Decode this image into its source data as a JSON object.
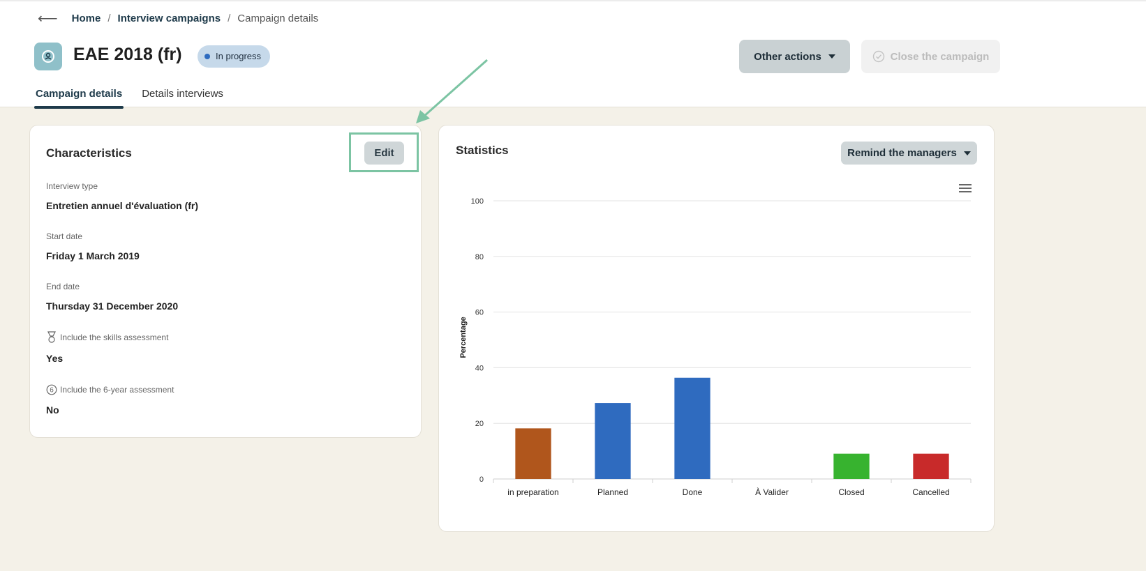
{
  "breadcrumb": {
    "back": "⟵",
    "home": "Home",
    "campaigns": "Interview campaigns",
    "current": "Campaign details",
    "separator": "/"
  },
  "header": {
    "title": "EAE 2018 (fr)",
    "status": "In progress",
    "status_color": "#2e6bbf",
    "other_actions": "Other actions",
    "close_campaign": "Close the campaign"
  },
  "tabs": [
    {
      "label": "Campaign details",
      "active": true
    },
    {
      "label": "Details interviews",
      "active": false
    }
  ],
  "characteristics": {
    "title": "Characteristics",
    "edit": "Edit",
    "fields": [
      {
        "label": "Interview type",
        "value": "Entretien annuel d'évaluation (fr)"
      },
      {
        "label": "Start date",
        "value": "Friday 1 March 2019"
      },
      {
        "label": "End date",
        "value": "Thursday 31 December 2020"
      },
      {
        "label": "Include the skills assessment",
        "value": "Yes",
        "icon": "medal-icon"
      },
      {
        "label": "Include the 6-year assessment",
        "value": "No",
        "icon": "six-circle-icon"
      }
    ]
  },
  "statistics": {
    "title": "Statistics",
    "remind": "Remind the managers"
  },
  "chart_data": {
    "type": "bar",
    "categories": [
      "in preparation",
      "Planned",
      "Done",
      "À Valider",
      "Closed",
      "Cancelled"
    ],
    "values": [
      18.2,
      27.3,
      36.4,
      0,
      9.1,
      9.1
    ],
    "colors": [
      "#b0561c",
      "#2f6bbf",
      "#2f6bbf",
      "#2f6bbf",
      "#37b32f",
      "#c82a2a"
    ],
    "ylabel": "Percentage",
    "ylim": [
      0,
      100
    ],
    "yticks": [
      0,
      20,
      40,
      60,
      80,
      100
    ],
    "grid": true
  },
  "colors": {
    "accent": "#1e3a4a",
    "highlight": "#7cc4a3",
    "background": "#f4f1e8"
  }
}
